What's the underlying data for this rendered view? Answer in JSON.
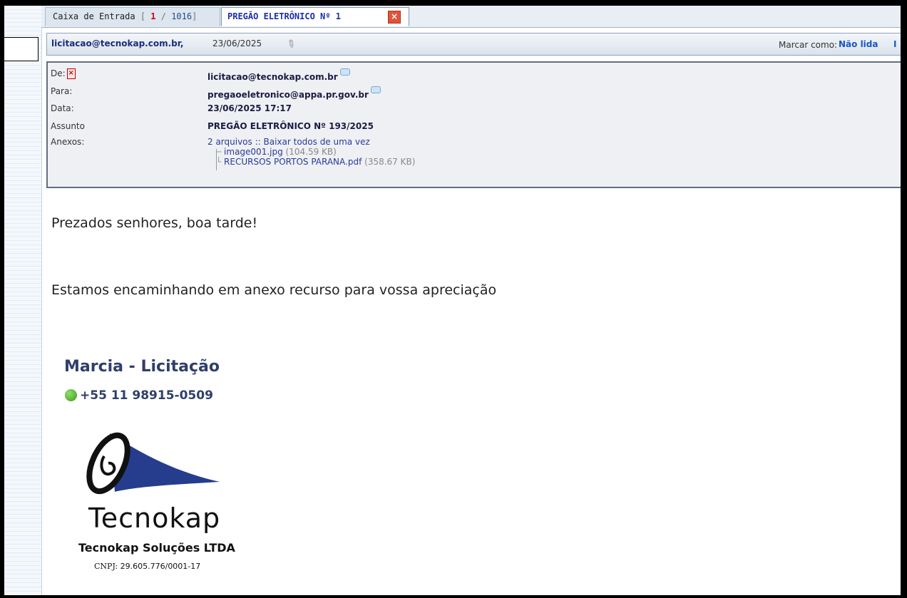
{
  "tabs": {
    "inbox": {
      "label": "Caixa de Entrada",
      "unread": "1",
      "total": "1016"
    },
    "message": {
      "label": "PREGÃO ELETRÔNICO Nº 1"
    }
  },
  "message_bar": {
    "from": "licitacao@tecnokap.com.br,",
    "date": "23/06/2025",
    "mark_as_label": "Marcar como:",
    "mark_as_value": "Não lida",
    "mark_as_extra": "I"
  },
  "headers": {
    "from_label": "De:",
    "from_value": "licitacao@tecnokap.com.br",
    "to_label": "Para:",
    "to_value": "pregaoeletronico@appa.pr.gov.br",
    "date_label": "Data:",
    "date_value": "23/06/2025 17:17",
    "subject_label": "Assunto",
    "subject_value": "PREGÃO ELETRÔNICO Nº 193/2025",
    "attachments_label": "Anexos:",
    "attachments_summary": "2 arquivos :: Baixar todos de uma vez",
    "attachments": [
      {
        "name": "image001.jpg",
        "size": "(104.59 KB)"
      },
      {
        "name": "RECURSOS PORTOS PARANA.pdf",
        "size": "(358.67 KB)"
      }
    ]
  },
  "body": {
    "greeting": "Prezados senhores, boa tarde!",
    "line1": "Estamos encaminhando em anexo recurso para vossa apreciação"
  },
  "signature": {
    "name": "Marcia - Licitação",
    "phone": "+55 11 98915-0509",
    "brand": "Tecnokap",
    "company": "Tecnokap Soluções LTDA",
    "cnpj_label": "CNPJ:",
    "cnpj_value": "29.605.776/0001-17"
  },
  "colors": {
    "accent": "#1c2fa6",
    "link": "#1a56c4",
    "signature": "#2f3f6b",
    "logo_blue": "#253d8c"
  }
}
